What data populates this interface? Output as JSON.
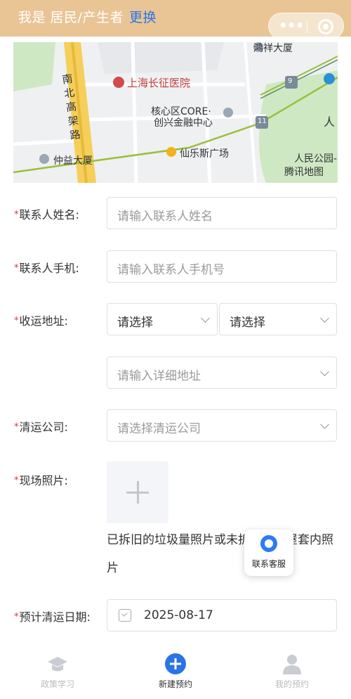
{
  "topbar": {
    "role_prefix": "我是 居民/产生者",
    "change_label": "更换"
  },
  "map": {
    "labels": {
      "hospital": "上海长征医院",
      "road": "南北高架路",
      "tower": "鸿祥大厦",
      "core": "核心区CORE·",
      "finance": "创兴金融中心",
      "zhongyi": "仲益大厦",
      "mall": "仙乐斯广场",
      "park": "人民公园-",
      "ren": "人",
      "provider": "腾讯地图",
      "metro9": "9",
      "metro11": "11"
    }
  },
  "form": {
    "name": {
      "label": "联系人姓名:",
      "placeholder": "请输入联系人姓名"
    },
    "phone": {
      "label": "联系人手机:",
      "placeholder": "请输入联系人手机号"
    },
    "address": {
      "label": "收运地址:",
      "select1": "请选择",
      "select2": "请选择",
      "detail_placeholder": "请输入详细地址"
    },
    "company": {
      "label": "清运公司:",
      "placeholder": "请选择清运公司"
    },
    "photo": {
      "label": "现场照片:",
      "hint": "已拆旧的垃圾量照片或未拆旧的房屋套内照片"
    },
    "date": {
      "label": "预计清运日期:",
      "value": "2025-08-17"
    }
  },
  "float_service": {
    "label": "联系客服"
  },
  "bottom_nav": {
    "tabs": [
      {
        "label": "政策学习",
        "icon": "graduation-cap-icon"
      },
      {
        "label": "新建预约",
        "icon": "plus-circle-icon"
      },
      {
        "label": "我的预约",
        "icon": "user-icon"
      }
    ]
  },
  "colors": {
    "topbar": "#e9c595",
    "accent": "#2b74e6",
    "required": "#d9373b"
  }
}
